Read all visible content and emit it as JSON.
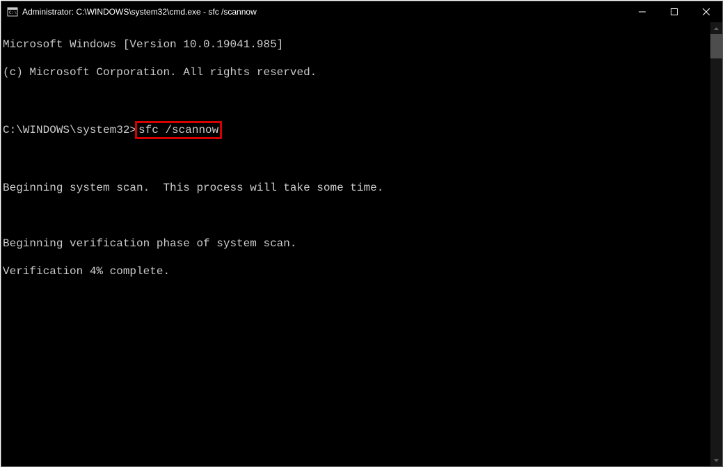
{
  "window": {
    "title": "Administrator: C:\\WINDOWS\\system32\\cmd.exe - sfc  /scannow"
  },
  "terminal": {
    "line1": "Microsoft Windows [Version 10.0.19041.985]",
    "line2": "(c) Microsoft Corporation. All rights reserved.",
    "blank1": "",
    "prompt_prefix": "C:\\WINDOWS\\system32>",
    "command": "sfc /scannow",
    "blank2": "",
    "line5": "Beginning system scan.  This process will take some time.",
    "blank3": "",
    "line7": "Beginning verification phase of system scan.",
    "line8": "Verification 4% complete."
  }
}
